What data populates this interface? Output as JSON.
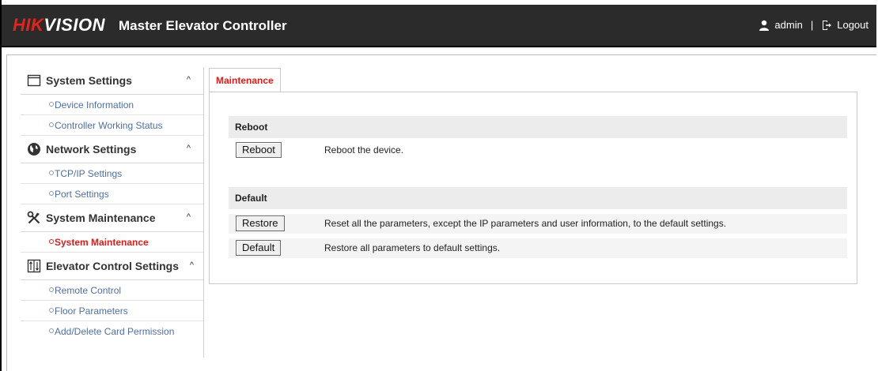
{
  "header": {
    "logo_hik": "HIK",
    "logo_vision": "VISION",
    "app_title": "Master Elevator Controller",
    "user_name": "admin",
    "separator": "|",
    "logout_label": "Logout"
  },
  "sidebar": {
    "groups": [
      {
        "label": "System Settings",
        "icon": "window-icon",
        "chevron": "^",
        "items": [
          {
            "label": "Device Information"
          },
          {
            "label": "Controller Working Status"
          }
        ]
      },
      {
        "label": "Network Settings",
        "icon": "globe-icon",
        "chevron": "^",
        "items": [
          {
            "label": "TCP/IP Settings"
          },
          {
            "label": "Port Settings"
          }
        ]
      },
      {
        "label": "System Maintenance",
        "icon": "tools-icon",
        "chevron": "^",
        "items": [
          {
            "label": "System Maintenance",
            "active": true
          }
        ]
      },
      {
        "label": "Elevator Control Settings",
        "icon": "elevator-icon",
        "chevron": "^",
        "items": [
          {
            "label": "Remote Control"
          },
          {
            "label": "Floor Parameters"
          },
          {
            "label": "Add/Delete Card Permission"
          }
        ]
      }
    ]
  },
  "main": {
    "tab_label": "Maintenance",
    "reboot_section": {
      "title": "Reboot",
      "button_label": "Reboot",
      "description": "Reboot the device."
    },
    "default_section": {
      "title": "Default",
      "restore_button": "Restore",
      "restore_description": "Reset all the parameters, except the IP parameters and user information, to the default settings.",
      "default_button": "Default",
      "default_description": "Restore all parameters to default settings."
    }
  },
  "colors": {
    "header_bg": "#2b2b2b",
    "brand_red": "#e2241a",
    "active_red": "#d6201b",
    "link_blue": "#4f6f9d"
  }
}
